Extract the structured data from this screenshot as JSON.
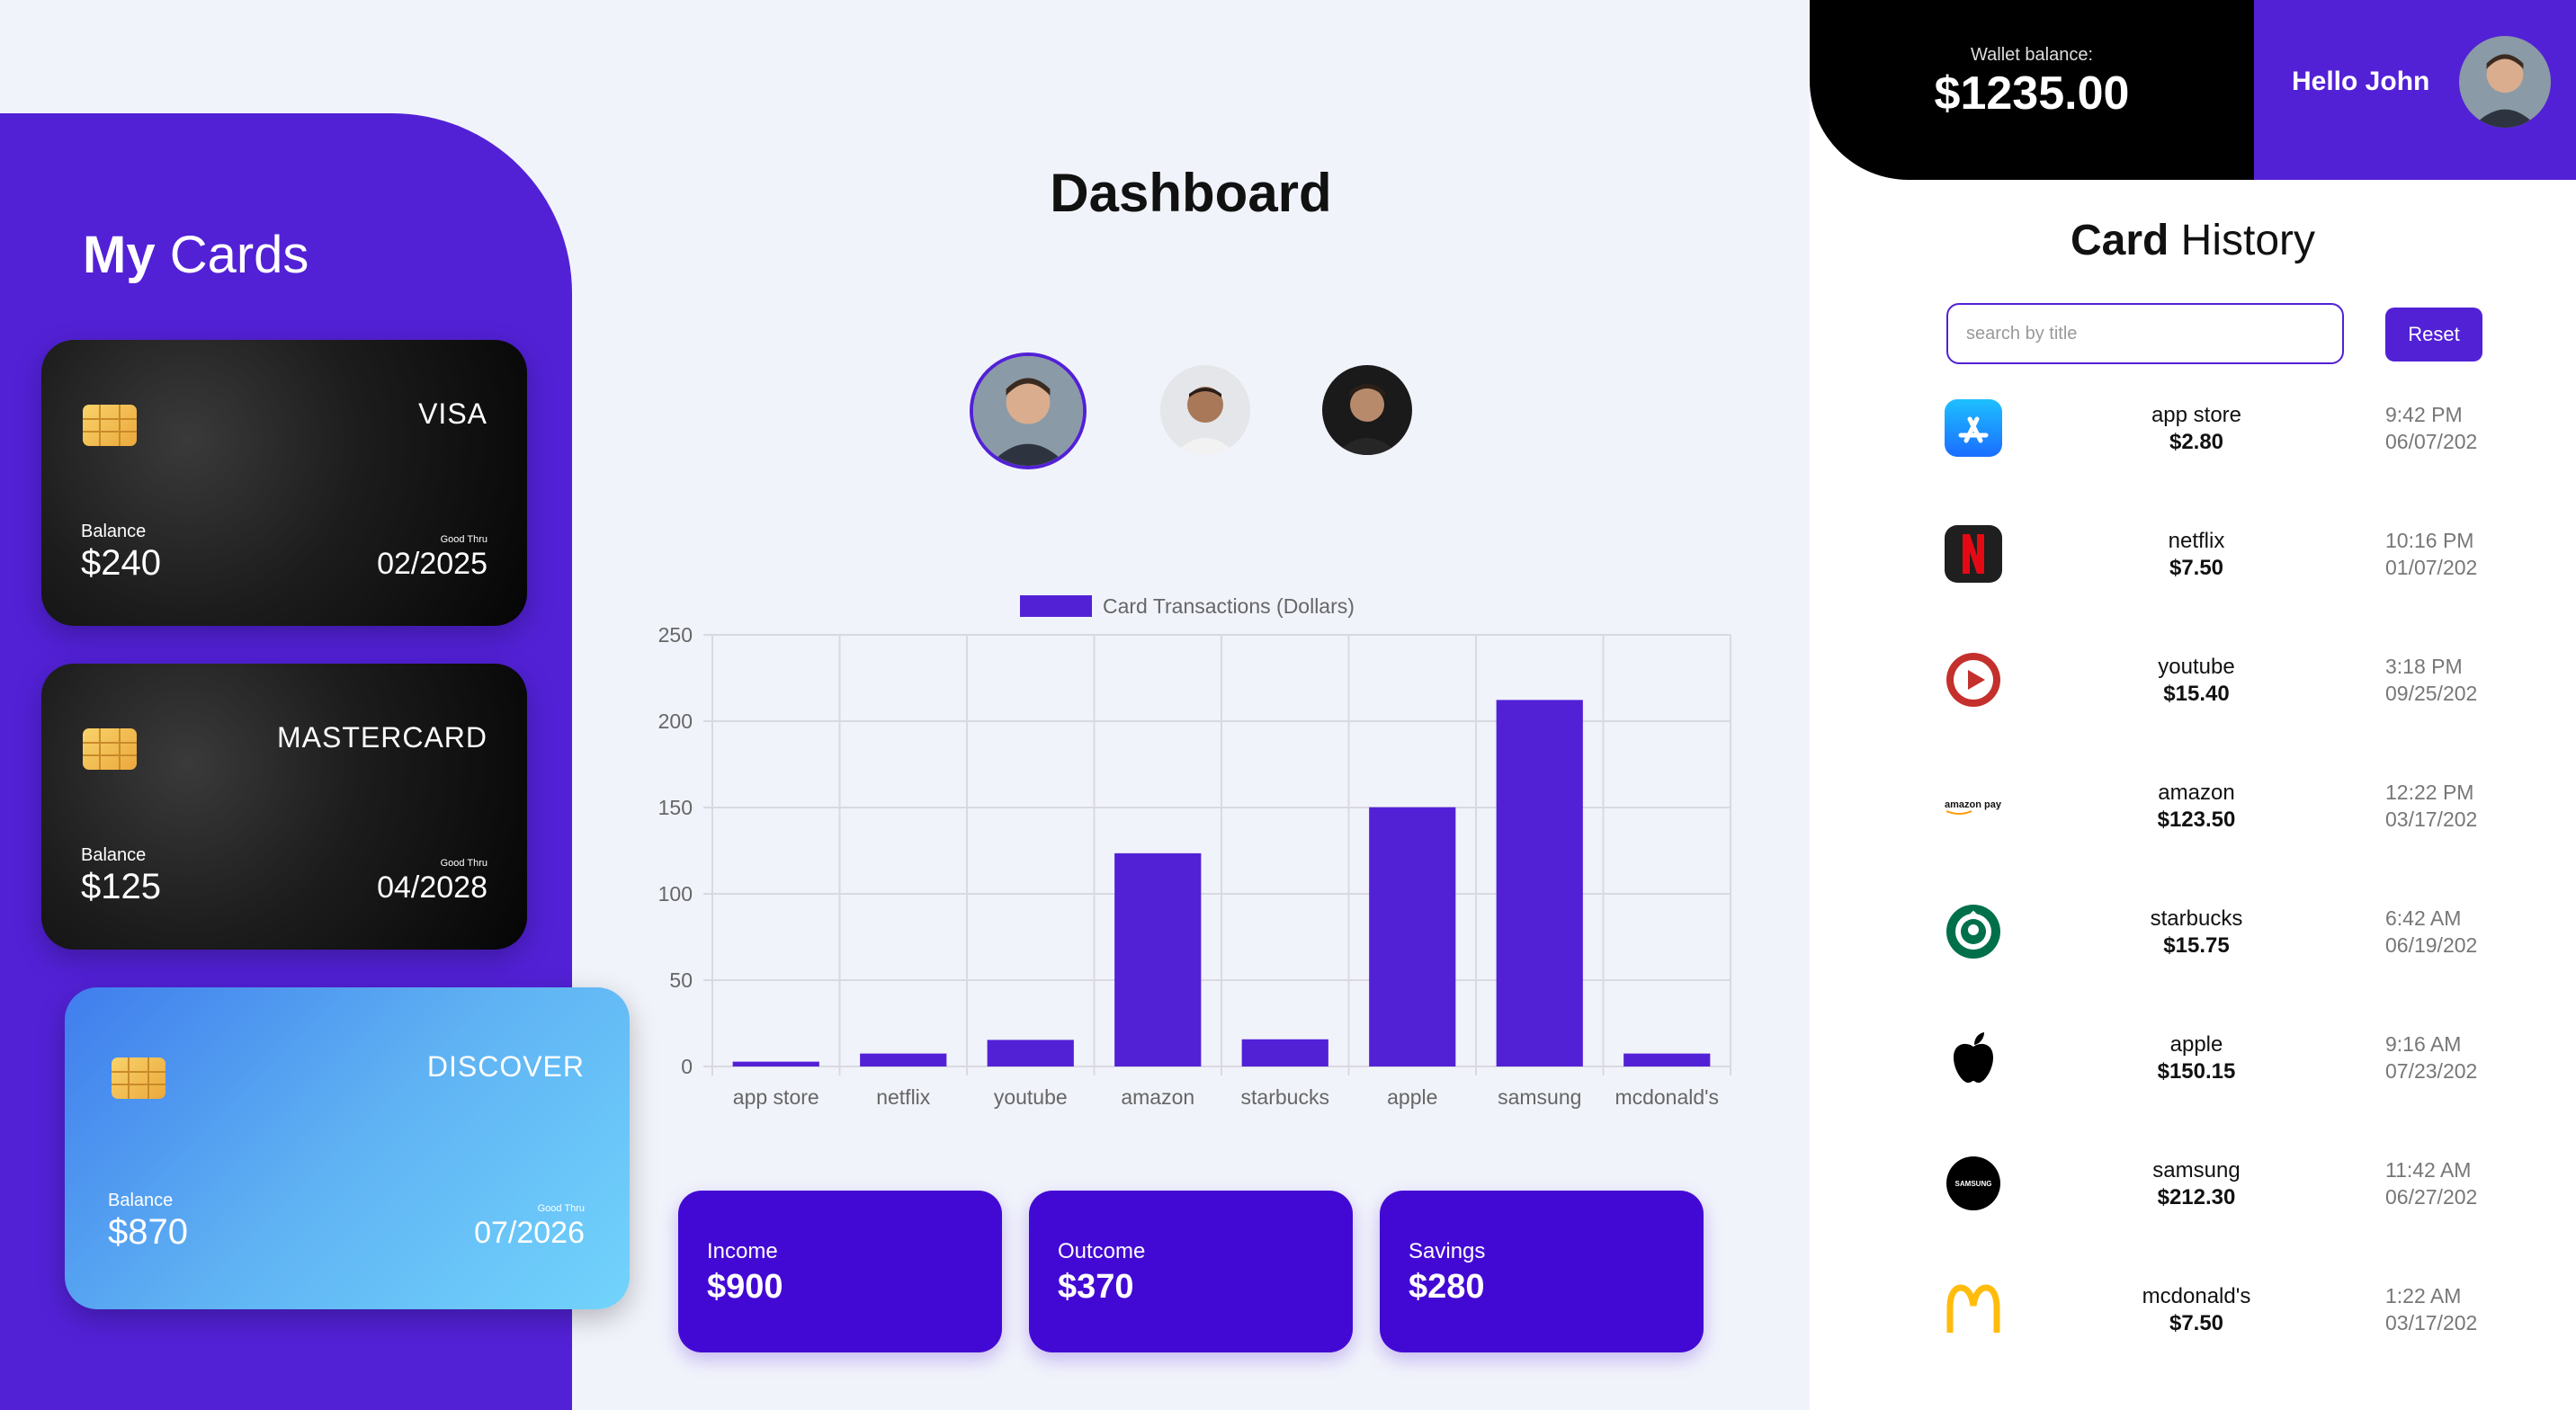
{
  "sidebar": {
    "title_bold": "My",
    "title_rest": " Cards",
    "cards": [
      {
        "brand": "VISA",
        "balance_label": "Balance",
        "balance": "$240",
        "good_thru_label": "Good Thru",
        "good_thru": "02/2025"
      },
      {
        "brand": "MASTERCARD",
        "balance_label": "Balance",
        "balance": "$125",
        "good_thru_label": "Good Thru",
        "good_thru": "04/2028"
      },
      {
        "brand": "DISCOVER",
        "balance_label": "Balance",
        "balance": "$870",
        "good_thru_label": "Good Thru",
        "good_thru": "07/2026"
      }
    ]
  },
  "main": {
    "title": "Dashboard",
    "stats": [
      {
        "label": "Income",
        "value": "$900"
      },
      {
        "label": "Outcome",
        "value": "$370"
      },
      {
        "label": "Savings",
        "value": "$280"
      }
    ]
  },
  "chart_data": {
    "type": "bar",
    "categories": [
      "app store",
      "netflix",
      "youtube",
      "amazon",
      "starbucks",
      "apple",
      "samsung",
      "mcdonald's"
    ],
    "series": [
      {
        "name": "Card Transactions (Dollars)",
        "values": [
          2.8,
          7.5,
          15.4,
          123.5,
          15.75,
          150.15,
          212.3,
          7.5
        ]
      }
    ],
    "ylim": [
      0,
      250
    ],
    "yticks": [
      0,
      50,
      100,
      150,
      200,
      250
    ],
    "grid": true,
    "legend": "top-center",
    "bar_color": "#5221d6"
  },
  "header": {
    "wallet_label": "Wallet balance:",
    "wallet_value": "$1235.00",
    "greeting": "Hello John"
  },
  "history": {
    "title_bold": "Card",
    "title_rest": " History",
    "search_placeholder": "search by title",
    "reset_label": "Reset",
    "items": [
      {
        "name": "app store",
        "amount": "$2.80",
        "time": "9:42 PM",
        "date": "06/07/202",
        "icon": "app-store-icon"
      },
      {
        "name": "netflix",
        "amount": "$7.50",
        "time": "10:16 PM",
        "date": "01/07/202",
        "icon": "netflix-icon"
      },
      {
        "name": "youtube",
        "amount": "$15.40",
        "time": "3:18 PM",
        "date": "09/25/202",
        "icon": "youtube-icon"
      },
      {
        "name": "amazon",
        "amount": "$123.50",
        "time": "12:22 PM",
        "date": "03/17/202",
        "icon": "amazon-pay-icon",
        "icon_text": "amazon pay"
      },
      {
        "name": "starbucks",
        "amount": "$15.75",
        "time": "6:42 AM",
        "date": "06/19/202",
        "icon": "starbucks-icon"
      },
      {
        "name": "apple",
        "amount": "$150.15",
        "time": "9:16 AM",
        "date": "07/23/202",
        "icon": "apple-icon"
      },
      {
        "name": "samsung",
        "amount": "$212.30",
        "time": "11:42 AM",
        "date": "06/27/202",
        "icon": "samsung-icon",
        "icon_text": "SAMSUNG"
      },
      {
        "name": "mcdonald's",
        "amount": "$7.50",
        "time": "1:22 AM",
        "date": "03/17/202",
        "icon": "mcdonalds-icon"
      }
    ]
  }
}
